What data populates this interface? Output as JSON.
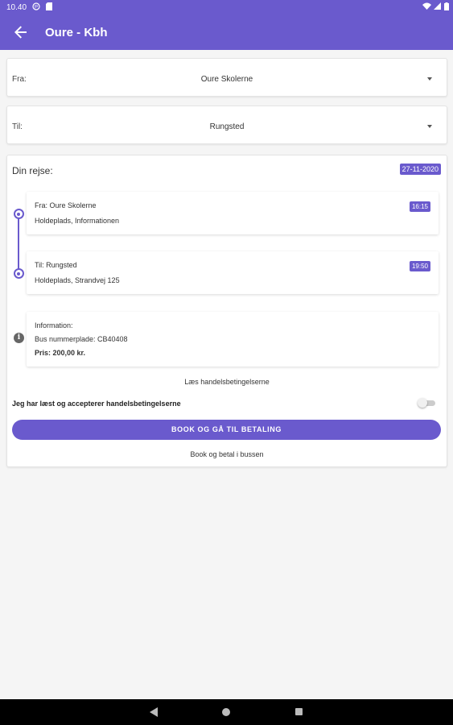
{
  "status_bar": {
    "time": "10.40",
    "icons": [
      "p-icon",
      "sd-card-icon",
      "wifi-icon",
      "signal-icon",
      "battery-icon"
    ]
  },
  "app_bar": {
    "title": "Oure - Kbh",
    "back_icon": "arrow-back-icon"
  },
  "from_select": {
    "label": "Fra:",
    "value": "Oure Skolerne"
  },
  "to_select": {
    "label": "Til:",
    "value": "Rungsted"
  },
  "trip": {
    "title": "Din rejse:",
    "date": "27-11-2020",
    "stops": [
      {
        "line1": "Fra: Oure Skolerne",
        "line2": "Holdeplads, Informationen",
        "time": "16:15"
      },
      {
        "line1": "Til: Rungsted",
        "line2": "Holdeplads, Strandvej 125",
        "time": "19:50"
      }
    ],
    "info": {
      "title": "Information:",
      "plate": "Bus nummerplade: CB40408",
      "price": "Pris: 200,00 kr."
    },
    "terms_link": "Læs handelsbetingelserne",
    "accept_text": "Jeg har læst og accepterer handelsbetingelserne",
    "accept_toggle_on": false,
    "book_button": "BOOK OG GÅ TIL BETALING",
    "book_bus_link": "Book og betal i bussen"
  },
  "colors": {
    "primary": "#6a5acd",
    "background": "#f5f5f5",
    "navbar": "#000000"
  }
}
